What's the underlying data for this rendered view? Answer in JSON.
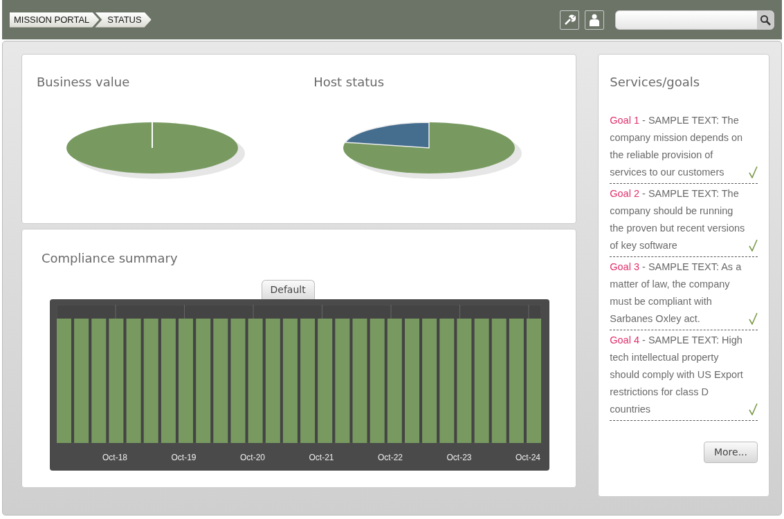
{
  "breadcrumb": [
    {
      "label": "MISSION PORTAL"
    },
    {
      "label": "STATUS"
    }
  ],
  "business_value": {
    "title": "Business value"
  },
  "host_status": {
    "title": "Host status"
  },
  "compliance": {
    "title": "Compliance summary",
    "legend": "Default",
    "x_labels": [
      "Oct-18",
      "Oct-19",
      "Oct-20",
      "Oct-21",
      "Oct-22",
      "Oct-23",
      "Oct-24"
    ]
  },
  "goals_panel": {
    "title": "Services/goals",
    "more_button": "More...",
    "goals": [
      {
        "label": "Goal 1",
        "text": " - SAMPLE TEXT: The company mission depends on the reliable provision of services to our customers",
        "done": true
      },
      {
        "label": "Goal 2",
        "text": " - SAMPLE TEXT: The company should be running the proven but recent versions of key software",
        "done": true
      },
      {
        "label": "Goal 3",
        "text": " - SAMPLE TEXT: As a matter of law, the company must be compliant with Sarbanes Oxley act.",
        "done": true
      },
      {
        "label": "Goal 4",
        "text": " - SAMPLE TEXT: High tech intellectual property should comply with US Export restrictions for class D countries",
        "done": true
      }
    ]
  }
}
